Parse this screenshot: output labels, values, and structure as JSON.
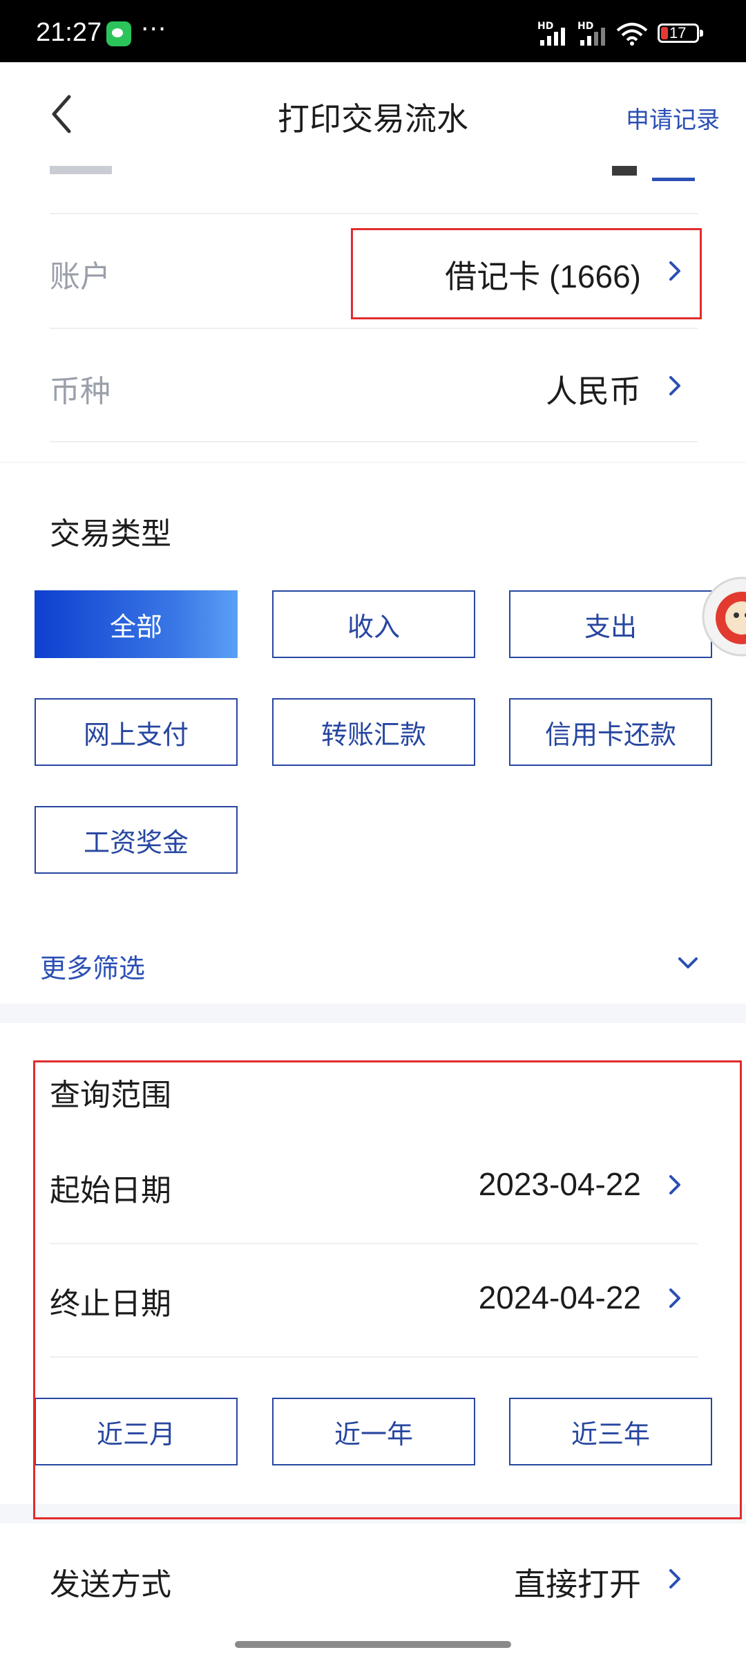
{
  "status_bar": {
    "time": "21:27",
    "dots": "···",
    "hd1": "HD",
    "hd2": "HD",
    "battery": "17",
    "icons": [
      "wechat-icon",
      "signal-icon",
      "wifi-icon",
      "battery-icon"
    ]
  },
  "nav": {
    "title": "打印交易流水",
    "right_link": "申请记录",
    "back_icon": "chevron-left-icon"
  },
  "account_section": {
    "account_label": "账户",
    "account_value": "借记卡 (1666)",
    "currency_label": "币种",
    "currency_value": "人民币"
  },
  "transaction_type": {
    "title": "交易类型",
    "options": [
      {
        "label": "全部",
        "active": true
      },
      {
        "label": "收入",
        "active": false
      },
      {
        "label": "支出",
        "active": false
      },
      {
        "label": "网上支付",
        "active": false
      },
      {
        "label": "转账汇款",
        "active": false
      },
      {
        "label": "信用卡还款",
        "active": false
      },
      {
        "label": "工资奖金",
        "active": false
      }
    ],
    "more_filter": "更多筛选"
  },
  "query_range": {
    "title": "查询范围",
    "start_label": "起始日期",
    "start_value": "2023-04-22",
    "end_label": "终止日期",
    "end_value": "2024-04-22",
    "quick_ranges": [
      "近三月",
      "近一年",
      "近三年"
    ]
  },
  "delivery": {
    "label": "发送方式",
    "value": "直接打开"
  },
  "colors": {
    "accent": "#2746a0",
    "link": "#2b4fb5",
    "highlight_box": "#e02c2c"
  }
}
